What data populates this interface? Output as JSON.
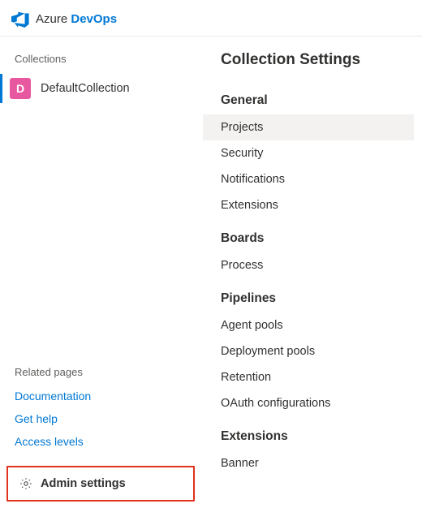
{
  "header": {
    "logo_prefix": "Azure ",
    "logo_bold": "DevOps"
  },
  "sidebar": {
    "collections_label": "Collections",
    "collection": {
      "initial": "D",
      "name": "DefaultCollection"
    },
    "related_label": "Related pages",
    "related_links": [
      {
        "label": "Documentation"
      },
      {
        "label": "Get help"
      },
      {
        "label": "Access levels"
      }
    ],
    "admin_label": "Admin settings"
  },
  "content": {
    "title": "Collection Settings",
    "groups": [
      {
        "heading": "General",
        "items": [
          {
            "label": "Projects",
            "selected": true
          },
          {
            "label": "Security"
          },
          {
            "label": "Notifications"
          },
          {
            "label": "Extensions"
          }
        ]
      },
      {
        "heading": "Boards",
        "items": [
          {
            "label": "Process"
          }
        ]
      },
      {
        "heading": "Pipelines",
        "items": [
          {
            "label": "Agent pools"
          },
          {
            "label": "Deployment pools"
          },
          {
            "label": "Retention"
          },
          {
            "label": "OAuth configurations"
          }
        ]
      },
      {
        "heading": "Extensions",
        "items": [
          {
            "label": "Banner"
          }
        ]
      }
    ]
  }
}
